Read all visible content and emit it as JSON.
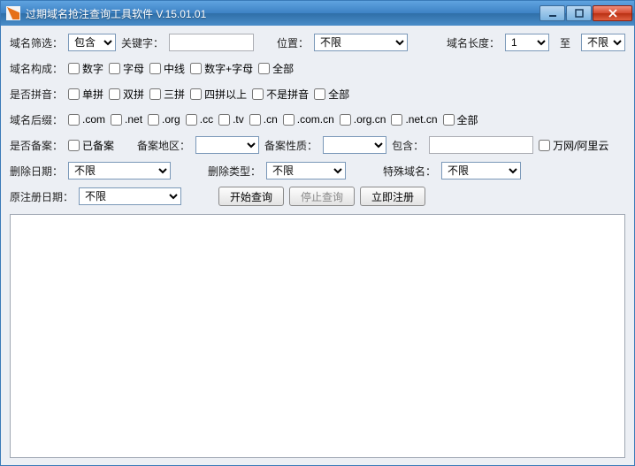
{
  "title": "过期域名抢注查询工具软件 V.15.01.01",
  "row1": {
    "filter_label": "域名筛选：",
    "contain_sel": "包含",
    "keyword_label": "关键字：",
    "pos_label": "位置：",
    "pos_sel": "不限",
    "len_label": "域名长度：",
    "len_from": "1",
    "to": "至",
    "len_to": "不限"
  },
  "row2": {
    "label": "域名构成：",
    "opts": [
      "数字",
      "字母",
      "中线",
      "数字+字母",
      "全部"
    ]
  },
  "row3": {
    "label": "是否拼音：",
    "opts": [
      "单拼",
      "双拼",
      "三拼",
      "四拼以上",
      "不是拼音",
      "全部"
    ]
  },
  "row4": {
    "label": "域名后缀：",
    "opts": [
      ".com",
      ".net",
      ".org",
      ".cc",
      ".tv",
      ".cn",
      ".com.cn",
      ".org.cn",
      ".net.cn",
      "全部"
    ]
  },
  "row5": {
    "label": "是否备案：",
    "opt1": "已备案",
    "region": "备案地区：",
    "nature": "备案性质：",
    "contain": "包含：",
    "wwaly": "万网/阿里云"
  },
  "row6": {
    "del_label": "删除日期：",
    "del_sel": "不限",
    "type_label": "删除类型：",
    "type_sel": "不限",
    "special_label": "特殊域名：",
    "special_sel": "不限"
  },
  "row7": {
    "orig_label": "原注册日期：",
    "orig_sel": "不限",
    "btn_start": "开始查询",
    "btn_stop": "停止查询",
    "btn_reg": "立即注册"
  }
}
